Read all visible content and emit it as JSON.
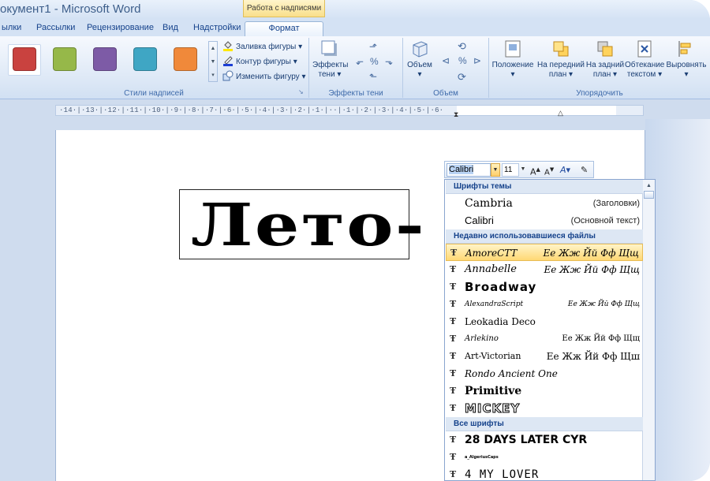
{
  "titlebar": {
    "doc_title": "окумент1 - Microsoft Word",
    "context_group": "Работа с надписями"
  },
  "tabs": [
    {
      "label": "ылки"
    },
    {
      "label": "Рассылки"
    },
    {
      "label": "Рецензирование"
    },
    {
      "label": "Вид"
    },
    {
      "label": "Надстройки"
    },
    {
      "label": "Формат",
      "active": true
    }
  ],
  "ribbon": {
    "styles_group": {
      "label": "Стили надписей",
      "swatches": [
        "#c9423f",
        "#96b849",
        "#7d5ba6",
        "#3fa6c4",
        "#f0893a"
      ],
      "fill": "Заливка фигуры",
      "outline": "Контур фигуры",
      "change": "Изменить фигуру"
    },
    "shadow_group": {
      "label": "Эффекты тени",
      "effects_line1": "Эффекты",
      "effects_line2": "тени"
    },
    "volume_group": {
      "label": "Объем",
      "volume": "Объем"
    },
    "arrange_group": {
      "label": "Упорядочить",
      "position": "Положение",
      "front_line1": "На передний",
      "front_line2": "план",
      "back_line1": "На задний",
      "back_line2": "план",
      "wrap_line1": "Обтекание",
      "wrap_line2": "текстом",
      "align": "Выровнять"
    }
  },
  "ruler": {
    "text": "·14·|·13·|·12·|·11·|·10·|·9·|·8·|·7·|·6·|·5·|·4·|·3·|·2·|·1·|··|·1·|·2·|·3·|·4·|·5·|·6·"
  },
  "document": {
    "textbox_text": "Лето-"
  },
  "font_toolbar": {
    "font_name": "Calibri",
    "font_size": "11"
  },
  "font_list": {
    "theme_header": "Шрифты темы",
    "theme_fonts": [
      {
        "name": "Cambria",
        "role": "(Заголовки)"
      },
      {
        "name": "Calibri",
        "role": "(Основной текст)"
      }
    ],
    "recent_header": "Недавно использовавшиеся файлы",
    "recent_fonts": [
      {
        "name": "AmoreCTT",
        "sample": "Ее Жж Йй Фф Щщ",
        "highlight": true
      },
      {
        "name": "Annabelle",
        "sample": "Ее Жж Йй Фф Щщ"
      },
      {
        "name": "Broadway",
        "sample": ""
      },
      {
        "name": "AlexandraScript",
        "sample": "Ее Жж Йй Фф Щщ"
      },
      {
        "name": "Leokadia Deco",
        "sample": ""
      },
      {
        "name": "Arlekino",
        "sample": "Ее Жж Йй Фф Щщ"
      },
      {
        "name": "Art-Victorian",
        "sample": "Ее Жж Йй Фф Щш"
      },
      {
        "name": "Rondo Ancient One",
        "sample": ""
      },
      {
        "name": "Primitive",
        "sample": ""
      },
      {
        "name": "MICKEY",
        "sample": ""
      }
    ],
    "all_header": "Все шрифты",
    "all_fonts": [
      {
        "name": "28 DAYS LATER CYR"
      },
      {
        "name": "a_AlgeriusCaps"
      },
      {
        "name": "4 MY LOVER"
      }
    ]
  },
  "colors": {
    "ribbon_text": "#15428b",
    "highlight": "#ffd874"
  }
}
